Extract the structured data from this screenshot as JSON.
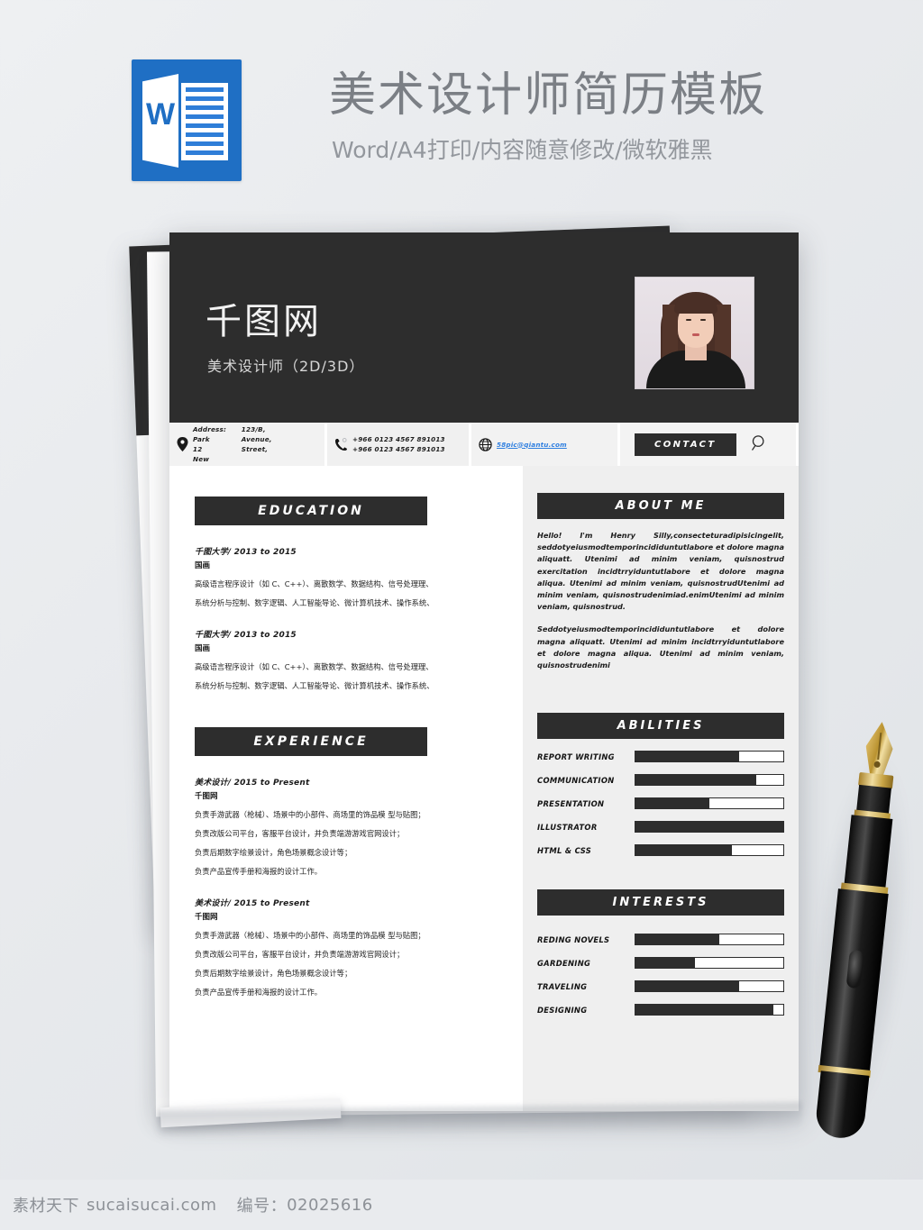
{
  "banner": {
    "icon_name": "word-document-icon",
    "icon_letter": "W",
    "title": "美术设计师简历模板",
    "subtitle": "Word/A4打印/内容随意修改/微软雅黑"
  },
  "back_sheet": {
    "name": "千图网",
    "role": "美术设计师（2D/3D）"
  },
  "resume": {
    "name": "千图网",
    "role": "美术设计师（2D/3D）",
    "photo_alt": "portrait-photo",
    "contact": {
      "address_label": "Address:",
      "address_parts": [
        "Address:",
        "123/B,",
        "Park",
        "Avenue,",
        "12",
        "Street,",
        "New"
      ],
      "phone_line1": "+966 0123 4567 891013",
      "phone_line2": "+966 0123 4567 891013",
      "email": "58pic@qiantu.com",
      "button_label": "CONTACT",
      "search_icon": "search-icon",
      "location_icon": "location-pin-icon",
      "phone_icon": "phone-icon",
      "globe_icon": "globe-icon"
    },
    "education": {
      "heading": "EDUCATION",
      "entries": [
        {
          "line1": "千图大学/ 2013 to 2015",
          "line2": "国画",
          "p1": "高级语言程序设计（如 C、C++）、离散数学、数据结构、信号处理理、",
          "p2": "系统分析与控制、数字逻辑、人工智能导论、微计算机技术、操作系统、"
        },
        {
          "line1": "千图大学/ 2013 to 2015",
          "line2": "国画",
          "p1": "高级语言程序设计（如 C、C++）、离散数学、数据结构、信号处理理、",
          "p2": "系统分析与控制、数字逻辑、人工智能导论、微计算机技术、操作系统、"
        }
      ]
    },
    "experience": {
      "heading": "EXPERIENCE",
      "entries": [
        {
          "line1": "美术设计/ 2015 to Present",
          "line2": "千图网",
          "p1": "负责手游武器（枪械）、场景中的小部件、商场里的饰品模 型与贴图；",
          "p2": "负责改版公司平台，客服平台设计，并负责端游游戏官网设计；",
          "p3": "负责后期数字绘景设计，角色场景概念设计等；",
          "p4": "负责产品宣传手册和海报的设计工作。"
        },
        {
          "line1": "美术设计/ 2015 to Present",
          "line2": "千图网",
          "p1": "负责手游武器（枪械）、场景中的小部件、商场里的饰品模 型与贴图；",
          "p2": "负责改版公司平台，客服平台设计，并负责端游游戏官网设计；",
          "p3": "负责后期数字绘景设计，角色场景概念设计等；",
          "p4": "负责产品宣传手册和海报的设计工作。"
        }
      ]
    },
    "about": {
      "heading": "ABOUT ME",
      "p1": "Hello! I'm Henry Silly,consecteturadipisicingelit, seddotyeiusmodtemporincididuntutlabore et dolore magna aliquatt. Utenimi ad minim veniam, quisnostrud exercitation incidtrryiduntutlabore et dolore magna aliqua. Utenimi ad minim veniam, quisnostrudUtenimi ad minim veniam, quisnostrudenimiad.enimUtenimi ad minim veniam, quisnostrud.",
      "p2": "Seddotyeiusmodtemporincididuntutlabore et dolore magna aliquatt. Utenimi ad minim incidtrryiduntutlabore et dolore magna aliqua. Utenimi ad minim veniam, quisnostrudenimi"
    },
    "abilities": {
      "heading": "ABILITIES",
      "items": [
        {
          "label": "REPORT WRITING",
          "value": 70
        },
        {
          "label": "COMMUNICATION",
          "value": 82
        },
        {
          "label": "PRESENTATION",
          "value": 50
        },
        {
          "label": "ILLUSTRATOR",
          "value": 100
        },
        {
          "label": "HTML & CSS",
          "value": 65
        }
      ]
    },
    "interests": {
      "heading": "INTERESTS",
      "items": [
        {
          "label": "REDING NOVELS",
          "value": 57
        },
        {
          "label": "GARDENING",
          "value": 40
        },
        {
          "label": "TRAVELING",
          "value": 70
        },
        {
          "label": "DESIGNING",
          "value": 93
        }
      ]
    }
  },
  "decor": {
    "pen": "fountain-pen"
  },
  "footer": {
    "brand": "素材天下",
    "site": "sucaisucai.com",
    "id_label": "编号：",
    "id_value": "02025616"
  },
  "colors": {
    "dark": "#2d2d2d",
    "accent_blue": "#1f6fc4",
    "link_blue": "#2f7fe0",
    "panel_gray": "#efefef",
    "page_bg": "#e8eaed"
  }
}
